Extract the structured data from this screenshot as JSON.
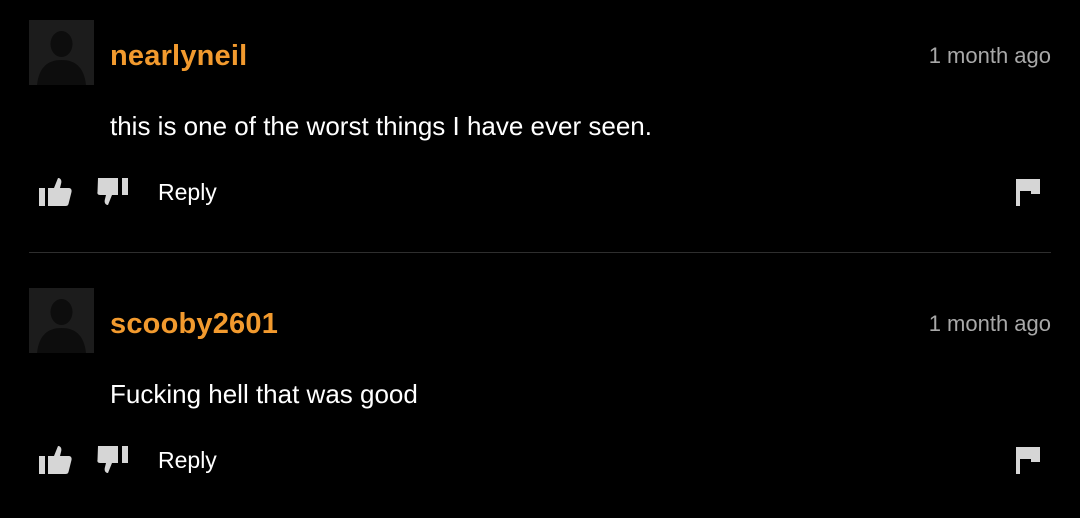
{
  "colors": {
    "background": "#000000",
    "username": "#f29a2e",
    "timestamp": "#a8a8a8",
    "text": "#ffffff",
    "icon": "#d6d6d6",
    "divider": "#2e2e2e"
  },
  "comments": [
    {
      "username": "nearlyneil",
      "timestamp": "1 month ago",
      "text": "this is one of the worst things I have ever seen.",
      "reply_label": "Reply",
      "icons": [
        "avatar-placeholder-icon",
        "thumbs-up-icon",
        "thumbs-down-icon",
        "flag-icon"
      ]
    },
    {
      "username": "scooby2601",
      "timestamp": "1 month ago",
      "text": "Fucking hell that was good",
      "reply_label": "Reply",
      "icons": [
        "avatar-placeholder-icon",
        "thumbs-up-icon",
        "thumbs-down-icon",
        "flag-icon"
      ]
    }
  ]
}
